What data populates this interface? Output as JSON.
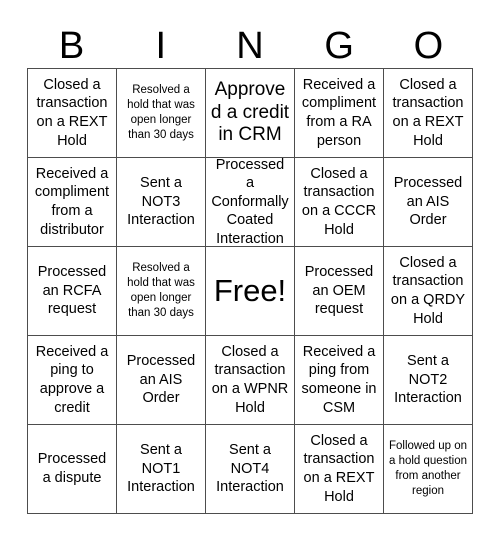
{
  "header": {
    "letters": [
      "B",
      "I",
      "N",
      "G",
      "O"
    ]
  },
  "grid": {
    "rows": 5,
    "columns": 5,
    "cells": [
      {
        "text": "Closed a transaction on a REXT Hold",
        "size": "normal"
      },
      {
        "text": "Resolved a hold that was open longer than 30 days",
        "size": "small"
      },
      {
        "text": "Approved a credit in CRM",
        "size": "large"
      },
      {
        "text": "Received a compliment from a RA person",
        "size": "normal"
      },
      {
        "text": "Closed a transaction on a REXT Hold",
        "size": "normal"
      },
      {
        "text": "Received a compliment from a distributor",
        "size": "normal"
      },
      {
        "text": "Sent a NOT3 Interaction",
        "size": "normal"
      },
      {
        "text": "Processed a Conformally Coated Interaction",
        "size": "normal"
      },
      {
        "text": "Closed a transaction on a CCCR Hold",
        "size": "normal"
      },
      {
        "text": "Processed an AIS Order",
        "size": "normal"
      },
      {
        "text": "Processed an RCFA request",
        "size": "normal"
      },
      {
        "text": "Resolved a hold that was open longer than 30 days",
        "size": "small"
      },
      {
        "text": "Free!",
        "size": "free"
      },
      {
        "text": "Processed an OEM request",
        "size": "normal"
      },
      {
        "text": "Closed a transaction on a QRDY Hold",
        "size": "normal"
      },
      {
        "text": "Received a ping to approve a credit",
        "size": "normal"
      },
      {
        "text": "Processed an AIS Order",
        "size": "normal"
      },
      {
        "text": "Closed a transaction on a WPNR Hold",
        "size": "normal"
      },
      {
        "text": "Received a ping from someone in CSM",
        "size": "normal"
      },
      {
        "text": "Sent a NOT2 Interaction",
        "size": "normal"
      },
      {
        "text": "Processed a dispute",
        "size": "normal"
      },
      {
        "text": "Sent a NOT1 Interaction",
        "size": "normal"
      },
      {
        "text": "Sent a NOT4 Interaction",
        "size": "normal"
      },
      {
        "text": "Closed a transaction on a REXT Hold",
        "size": "normal"
      },
      {
        "text": "Followed up on a hold question from another region",
        "size": "small"
      }
    ]
  },
  "colors": {
    "background": "#ffffff",
    "text": "#000000",
    "gridline": "#4d4d4d"
  }
}
